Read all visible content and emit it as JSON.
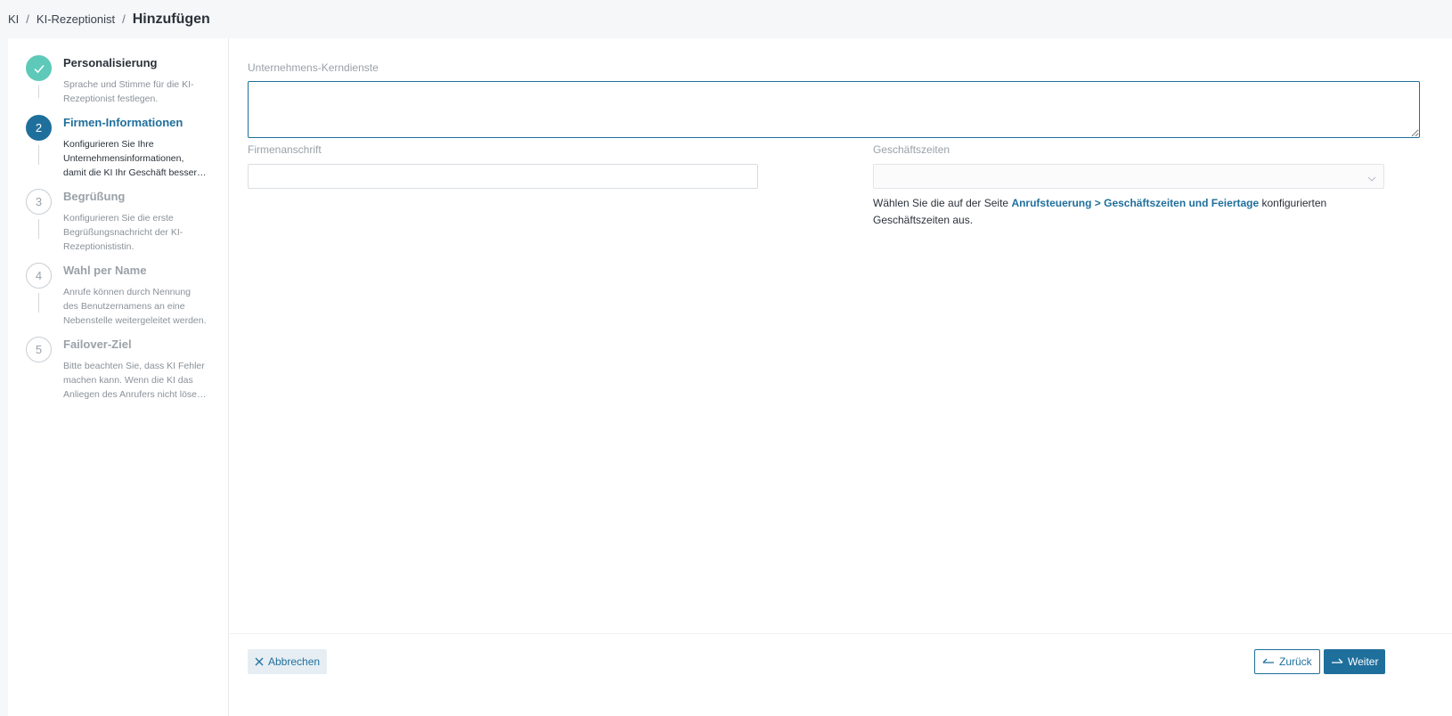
{
  "breadcrumb": {
    "items": [
      "KI",
      "KI-Rezeptionist"
    ],
    "separator": "/",
    "current": "Hinzufügen"
  },
  "steps": [
    {
      "number": "1",
      "state": "done",
      "title": "Personalisierung",
      "desc_lines": [
        "Sprache und Stimme für die KI-",
        "Rezeptionist festlegen."
      ]
    },
    {
      "number": "2",
      "state": "active",
      "title": "Firmen-Informationen",
      "desc_lines": [
        "Konfigurieren Sie Ihre",
        "Unternehmensinformationen,",
        "damit die KI Ihr Geschäft besser…"
      ]
    },
    {
      "number": "3",
      "state": "pending",
      "title": "Begrüßung",
      "desc_lines": [
        "Konfigurieren Sie die erste",
        "Begrüßungsnachricht der KI-",
        "Rezeptionististin."
      ]
    },
    {
      "number": "4",
      "state": "pending",
      "title": "Wahl per Name",
      "desc_lines": [
        "Anrufe können durch Nennung",
        "des Benutzernamens an eine",
        "Nebenstelle weitergeleitet werden."
      ]
    },
    {
      "number": "5",
      "state": "pending",
      "title": "Failover-Ziel",
      "desc_lines": [
        "Bitte beachten Sie, dass KI Fehler",
        "machen kann. Wenn die KI das",
        "Anliegen des Anrufers nicht löse…"
      ]
    }
  ],
  "form": {
    "core_services_label": "Unternehmens-Kerndienste",
    "core_services_value": "",
    "address_label": "Firmenanschrift",
    "address_value": "",
    "hours_label": "Geschäftszeiten",
    "hours_value": "",
    "hint_before": "Wählen Sie die auf der Seite ",
    "hint_link": "Anrufsteuerung > Geschäftszeiten und Feiertage",
    "hint_after": " konfigurierten Geschäftszeiten aus."
  },
  "footer": {
    "cancel_label": "Abbrechen",
    "back_label": "Zurück",
    "next_label": "Weiter"
  },
  "colors": {
    "primary": "#1f6f9c",
    "done": "#5ec9b9"
  }
}
